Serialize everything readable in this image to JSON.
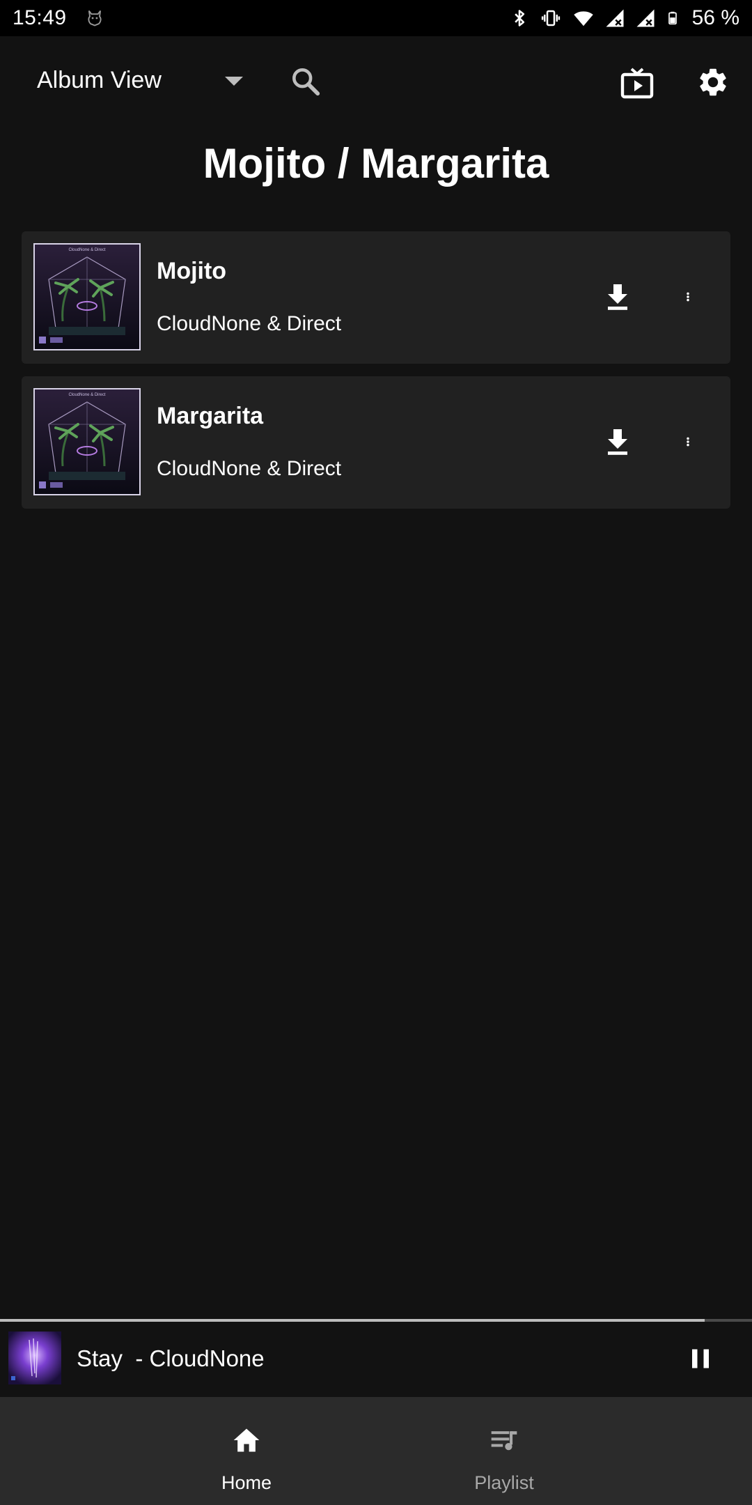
{
  "status_bar": {
    "time": "15:49",
    "battery_percent": "56 %"
  },
  "top_bar": {
    "view_select_label": "Album View"
  },
  "album": {
    "title": "Mojito / Margarita"
  },
  "tracks": [
    {
      "title": "Mojito",
      "artist": "CloudNone & Direct"
    },
    {
      "title": "Margarita",
      "artist": "CloudNone & Direct"
    }
  ],
  "mini_player": {
    "now_playing": "Stay  - CloudNone",
    "progress": 0.937
  },
  "bottom_nav": {
    "items": [
      {
        "label": "Home",
        "active": true
      },
      {
        "label": "Playlist",
        "active": false
      }
    ]
  },
  "colors": {
    "background": "#121212",
    "card": "#212121",
    "bottom_nav": "#2b2b2b",
    "text": "#ffffff",
    "inactive_text": "#a8a8a8"
  }
}
